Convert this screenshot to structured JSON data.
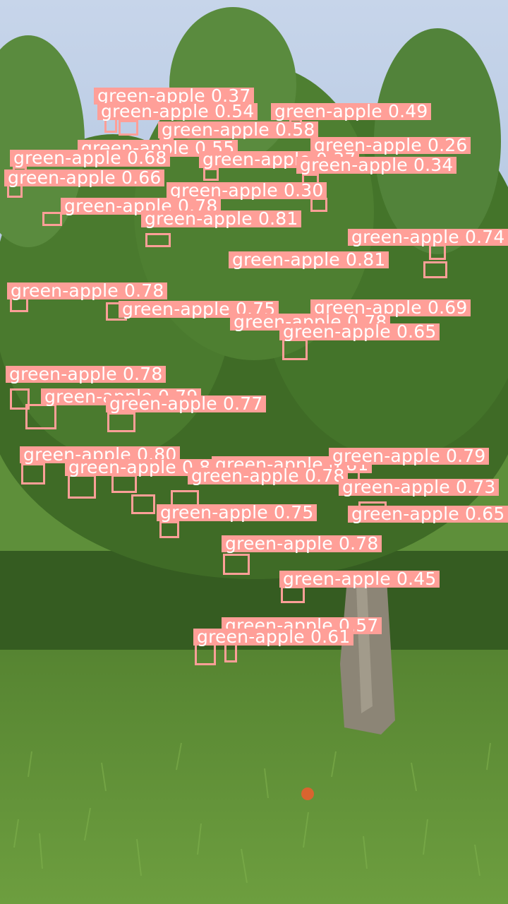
{
  "image": {
    "subject": "apple orchard tree with green apples against a blue sky",
    "colors": {
      "sky": "#b9cbe3",
      "foliage": "#3f6b26",
      "grass": "#5e8f3a",
      "trunk": "#8a8272",
      "apple": "#d7e35a",
      "box": "#ff9f98",
      "label_text": "#ffffff"
    }
  },
  "detections": [
    {
      "label": "green-apple",
      "score": "0.37"
    },
    {
      "label": "green-apple",
      "score": "0.54"
    },
    {
      "label": "green-apple",
      "score": "0.49"
    },
    {
      "label": "green-apple",
      "score": "0.58"
    },
    {
      "label": "green-apple",
      "score": "0.55"
    },
    {
      "label": "green-apple",
      "score": "0.26"
    },
    {
      "label": "green-apple",
      "score": "0.68"
    },
    {
      "label": "green-apple",
      "score": "0.37"
    },
    {
      "label": "green-apple",
      "score": "0.34"
    },
    {
      "label": "green-apple",
      "score": "0.66"
    },
    {
      "label": "green-apple",
      "score": "0.30"
    },
    {
      "label": "green-apple",
      "score": "0.78"
    },
    {
      "label": "green-apple",
      "score": "0.81"
    },
    {
      "label": "green-apple",
      "score": "0.74"
    },
    {
      "label": "green-apple",
      "score": "0.81"
    },
    {
      "label": "green-apple",
      "score": "0.78"
    },
    {
      "label": "green-apple",
      "score": "0.75"
    },
    {
      "label": "green-apple",
      "score": "0.69"
    },
    {
      "label": "green-apple",
      "score": "0.78"
    },
    {
      "label": "green-apple",
      "score": "0.65"
    },
    {
      "label": "green-apple",
      "score": "0.78"
    },
    {
      "label": "green-apple",
      "score": "0.79"
    },
    {
      "label": "green-apple",
      "score": "0.77"
    },
    {
      "label": "green-apple",
      "score": "0.80"
    },
    {
      "label": "green-apple",
      "score": "0.81"
    },
    {
      "label": "green-apple",
      "score": "0.81"
    },
    {
      "label": "green-apple",
      "score": "0.79"
    },
    {
      "label": "green-apple",
      "score": "0.78"
    },
    {
      "label": "green-apple",
      "score": "0.73"
    },
    {
      "label": "green-apple",
      "score": "0.75"
    },
    {
      "label": "green-apple",
      "score": "0.65"
    },
    {
      "label": "green-apple",
      "score": "0.78"
    },
    {
      "label": "green-apple",
      "score": "0.45"
    },
    {
      "label": "green-apple",
      "score": "0.57"
    },
    {
      "label": "green-apple",
      "score": "0.61"
    }
  ]
}
